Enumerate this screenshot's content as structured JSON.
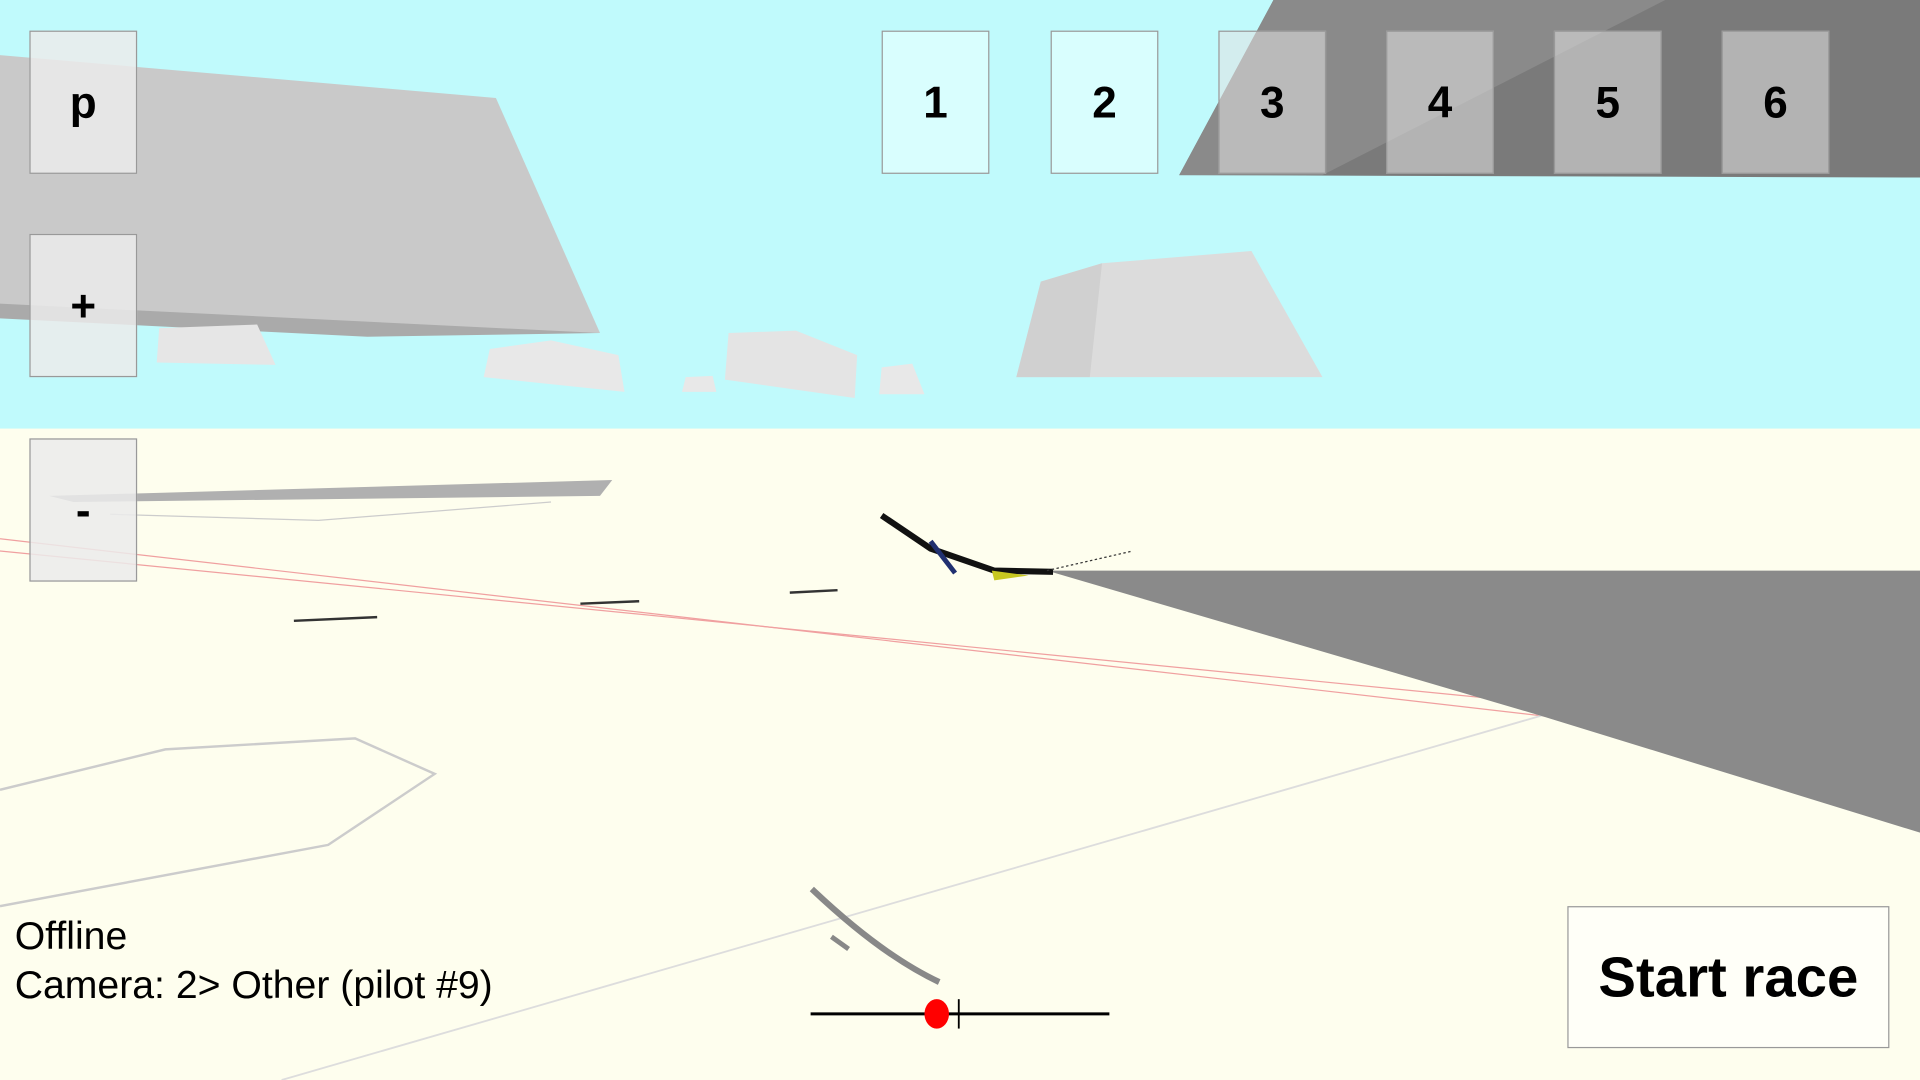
{
  "controls": {
    "pause_label": "p",
    "zoom_in_label": "+",
    "zoom_out_label": "-"
  },
  "camera_buttons": [
    "1",
    "2",
    "3",
    "4",
    "5",
    "6"
  ],
  "status": {
    "connection": "Offline",
    "camera": "Camera: 2> Other (pilot #9)"
  },
  "start_race_label": "Start race",
  "colors": {
    "sky": "#c0fafc",
    "ground": "#fefeee",
    "throttle_indicator": "#ff0000"
  }
}
